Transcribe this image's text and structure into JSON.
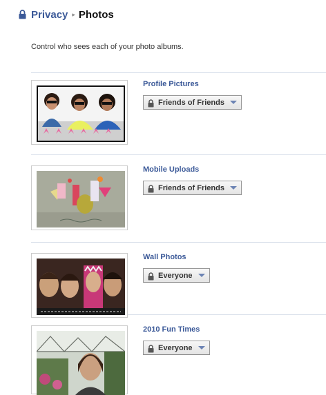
{
  "breadcrumb": {
    "parent": "Privacy",
    "separator": "▸",
    "current": "Photos"
  },
  "intro": "Control who sees each of your photo albums.",
  "albums": [
    {
      "title": "Profile Pictures",
      "privacy": "Friends of Friends"
    },
    {
      "title": "Mobile Uploads",
      "privacy": "Friends of Friends"
    },
    {
      "title": "Wall Photos",
      "privacy": "Everyone"
    },
    {
      "title": "2010 Fun Times",
      "privacy": "Everyone"
    }
  ],
  "colors": {
    "link": "#3b5998",
    "divider": "#d8dfea",
    "caret": "#6d84b4"
  },
  "icons": {
    "breadcrumb": "lock-icon",
    "button": "lock-icon",
    "dropdown": "caret-down-icon"
  }
}
